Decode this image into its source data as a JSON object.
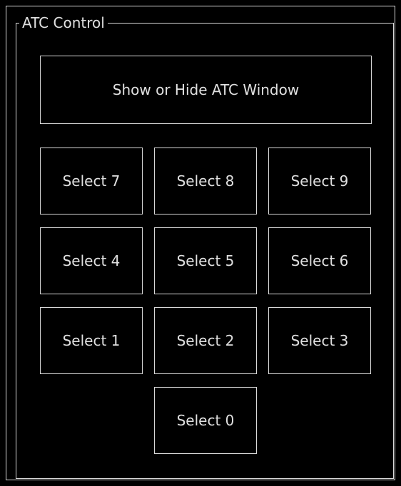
{
  "group": {
    "title": "ATC Control"
  },
  "buttons": {
    "show_hide": "Show or Hide ATC Window",
    "keypad": [
      "Select 7",
      "Select 8",
      "Select 9",
      "Select 4",
      "Select 5",
      "Select 6",
      "Select 1",
      "Select 2",
      "Select 3",
      "Select 0"
    ]
  }
}
